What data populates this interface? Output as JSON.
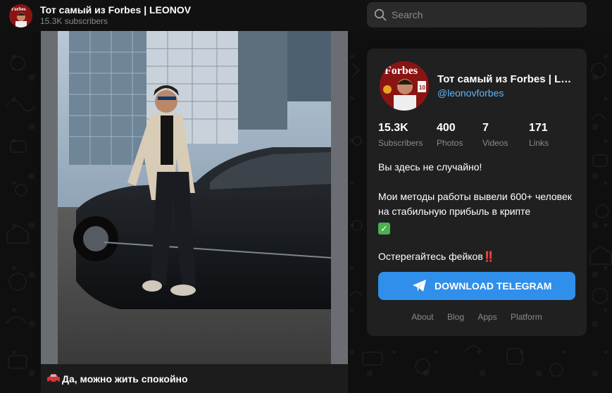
{
  "header": {
    "title": "Тот самый из Forbes | LEONOV",
    "subscribers": "15.3K subscribers"
  },
  "search": {
    "placeholder": "Search"
  },
  "post": {
    "caption": "Да, можно жить спокойно",
    "caption_emoji": "car-emoji"
  },
  "card": {
    "title": "Тот самый из Forbes | LEONOV",
    "handle": "@leonovforbes",
    "stats": [
      {
        "value": "15.3K",
        "label": "Subscribers"
      },
      {
        "value": "400",
        "label": "Photos"
      },
      {
        "value": "7",
        "label": "Videos"
      },
      {
        "value": "171",
        "label": "Links"
      }
    ],
    "description": {
      "line1": "Вы здесь не случайно!",
      "line2": "Мои методы работы вывели 600+ человек на стабильную прибыль в крипте",
      "line3": "Остерегайтесь фейков",
      "line3_emoji": "‼️"
    },
    "download_label": "DOWNLOAD TELEGRAM",
    "footer_links": [
      "About",
      "Blog",
      "Apps",
      "Platform"
    ]
  },
  "colors": {
    "accent": "#2f8fea",
    "link": "#5eb5f7",
    "card_bg": "#202021",
    "page_bg": "#0e0e0e"
  }
}
